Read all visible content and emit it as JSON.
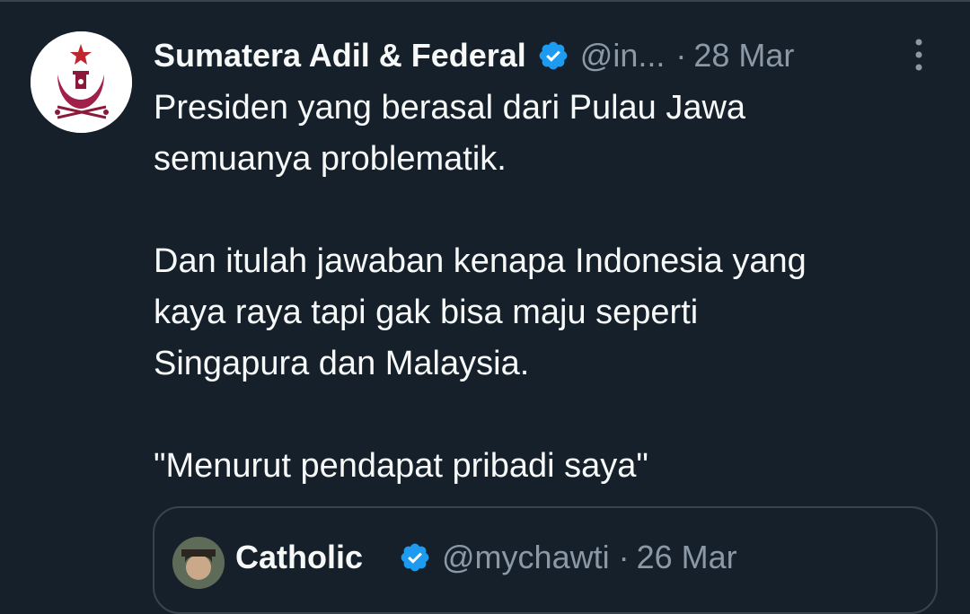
{
  "colors": {
    "background": "#15202b",
    "text_primary": "#f7f9f9",
    "text_secondary": "#8b98a5",
    "verified_blue": "#1d9bf0",
    "border": "#38444d"
  },
  "tweet": {
    "author_name": "Sumatera Adil & Federal",
    "author_handle": "@in...",
    "separator": "·",
    "date": "28 Mar",
    "verified_icon": "verified-badge-icon",
    "more_icon": "more-vertical-icon",
    "text": "Presiden yang berasal dari Pulau Jawa\nsemuanya problematik.\n\nDan itulah jawaban kenapa Indonesia yang\nkaya raya tapi gak bisa maju seperti\nSingapura dan Malaysia.\n\n\"Menurut pendapat pribadi saya\""
  },
  "quoted_tweet": {
    "author_name": "Catholic",
    "author_handle": "@mychawti",
    "separator": "·",
    "date": "26 Mar",
    "verified_icon": "verified-badge-icon"
  }
}
